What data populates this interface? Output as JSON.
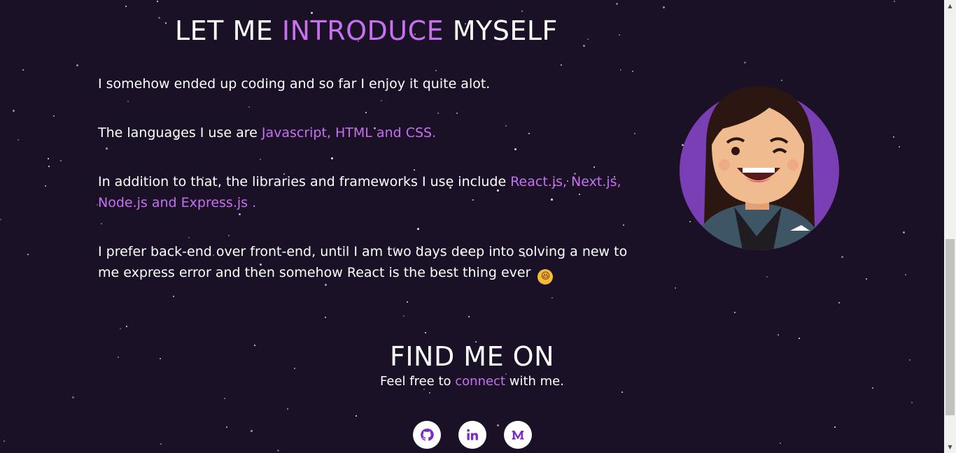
{
  "about": {
    "title_pre": "LET ME ",
    "title_accent": "INTRODUCE",
    "title_post": " MYSELF",
    "p1": "I somehow ended up coding and so far I enjoy it quite alot.",
    "p2_pre": "The languages I use are ",
    "p2_accent": "Javascript, HTML and CSS.",
    "p3_pre": "In addition to that, the libraries and frameworks I use include ",
    "p3_accent": "React.js, Next.js, Node.js and Express.js",
    "p3_post": " .",
    "p4": "I prefer back-end over front-end, until I am two days deep into solving a new to me express error and then somehow React is the best thing ever",
    "p4_emoji": "😆"
  },
  "find": {
    "title": "FIND ME ON",
    "sub_pre": "Feel free to ",
    "sub_accent": "connect",
    "sub_post": " with me."
  },
  "social": {
    "github_icon": "github-icon",
    "linkedin_icon": "linkedin-icon",
    "medium_icon": "medium-icon"
  },
  "colors": {
    "background": "#1a1126",
    "accent": "#c770f0",
    "avatar_circle": "#7b3fb5"
  }
}
